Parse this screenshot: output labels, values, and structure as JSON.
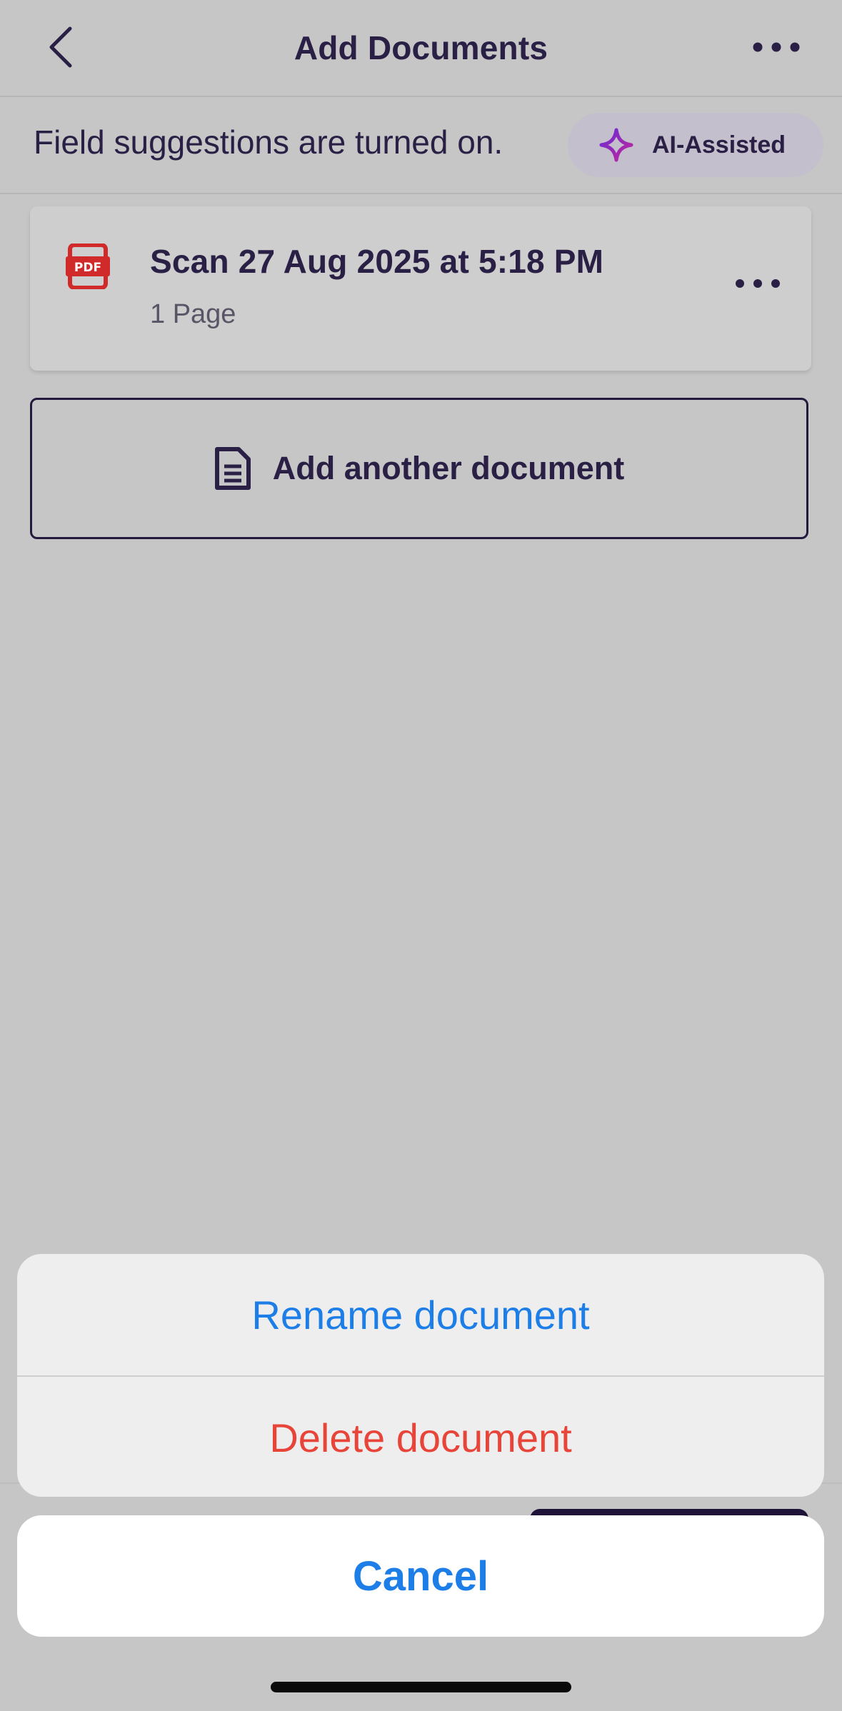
{
  "navbar": {
    "title": "Add Documents",
    "back_icon": "chevron-left-icon",
    "more_icon": "more-horizontal-icon"
  },
  "banner": {
    "text": "Field suggestions are turned on.",
    "ai_label": "AI-Assisted",
    "ai_icon": "sparkle-icon"
  },
  "document": {
    "title": "Scan 27 Aug 2025 at 5:18 PM",
    "pages": "1 Page",
    "icon": "pdf-icon",
    "icon_label": "PDF"
  },
  "add_document": {
    "label": "Add another document",
    "icon": "document-icon"
  },
  "action_sheet": {
    "rename_label": "Rename document",
    "delete_label": "Delete document",
    "cancel_label": "Cancel"
  },
  "colors": {
    "text_primary": "#2a1f45",
    "ios_blue": "#1d7ee8",
    "destructive_red": "#e8453a",
    "pdf_red": "#d12a2a"
  }
}
